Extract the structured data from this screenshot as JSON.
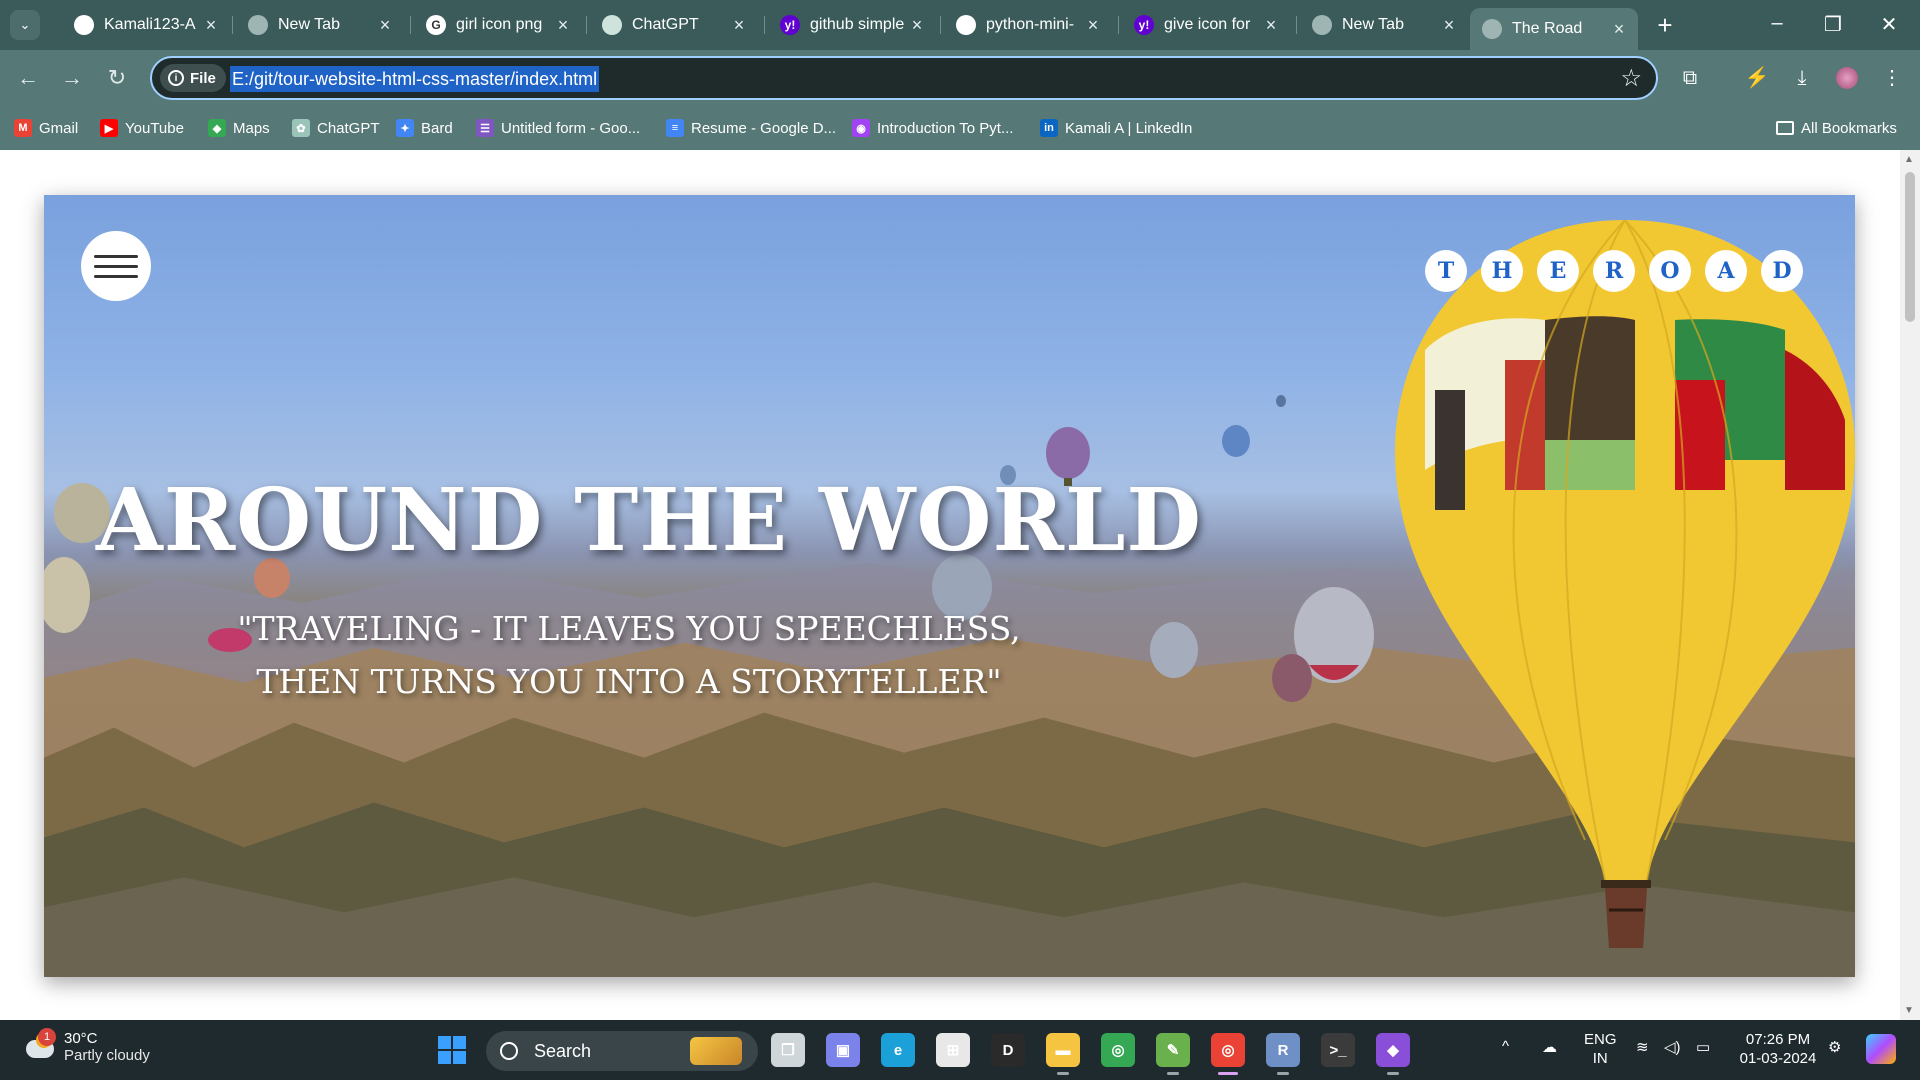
{
  "browser": {
    "tabs": [
      {
        "label": "Kamali123-A",
        "icon": "github-icon",
        "color": "#ffffff",
        "glyph": "",
        "active": false
      },
      {
        "label": "New Tab",
        "icon": "globe-icon",
        "color": "#9fb5b4",
        "glyph": "",
        "active": false
      },
      {
        "label": "girl icon png",
        "icon": "google-icon",
        "color": "#ffffff",
        "glyph": "G",
        "active": false
      },
      {
        "label": "ChatGPT",
        "icon": "chatgpt-icon",
        "color": "#cfe3dd",
        "glyph": "",
        "active": false
      },
      {
        "label": "github simple",
        "icon": "yahoo-icon",
        "color": "#6001d2",
        "glyph": "y!",
        "active": false
      },
      {
        "label": "python-mini-",
        "icon": "github-icon",
        "color": "#ffffff",
        "glyph": "",
        "active": false
      },
      {
        "label": "give icon for",
        "icon": "yahoo-icon",
        "color": "#6001d2",
        "glyph": "y!",
        "active": false
      },
      {
        "label": "New Tab",
        "icon": "globe-icon",
        "color": "#9fb5b4",
        "glyph": "",
        "active": false
      },
      {
        "label": "The Road",
        "icon": "globe-icon",
        "color": "#9fb5b4",
        "glyph": "",
        "active": true
      }
    ],
    "address": {
      "scheme_label": "File",
      "url": "E:/git/tour-website-html-css-master/index.html"
    },
    "bookmarks": [
      {
        "label": "Gmail",
        "icon": "gmail-icon",
        "color": "#ea4335",
        "glyph": "M"
      },
      {
        "label": "YouTube",
        "icon": "youtube-icon",
        "color": "#ff0000",
        "glyph": "▶"
      },
      {
        "label": "Maps",
        "icon": "maps-icon",
        "color": "#34a853",
        "glyph": "◆"
      },
      {
        "label": "ChatGPT",
        "icon": "chatgpt-icon",
        "color": "#9bc4b8",
        "glyph": "✿"
      },
      {
        "label": "Bard",
        "icon": "bard-icon",
        "color": "#4285f4",
        "glyph": "✦"
      },
      {
        "label": "Untitled form - Goo...",
        "icon": "google-forms-icon",
        "color": "#7e57c2",
        "glyph": "☰"
      },
      {
        "label": "Resume - Google D...",
        "icon": "google-docs-icon",
        "color": "#4285f4",
        "glyph": "≡"
      },
      {
        "label": "Introduction To Pyt...",
        "icon": "course-icon",
        "color": "#a142f4",
        "glyph": "◉"
      },
      {
        "label": "Kamali A | LinkedIn",
        "icon": "linkedin-icon",
        "color": "#0a66c2",
        "glyph": "in"
      }
    ],
    "all_bookmarks_label": "All Bookmarks"
  },
  "page": {
    "brand_letters": [
      "T",
      "H",
      "E",
      "R",
      "O",
      "A",
      "D"
    ],
    "headline": "AROUND THE WORLD",
    "quote_line1": "\"TRAVELING - IT LEAVES YOU SPEECHLESS,",
    "quote_line2": "THEN TURNS YOU INTO A STORYTELLER\""
  },
  "taskbar": {
    "weather": {
      "temp": "30°C",
      "condition": "Partly cloudy",
      "badge": "1"
    },
    "search_label": "Search",
    "language": {
      "line1": "ENG",
      "line2": "IN"
    },
    "time": "07:26 PM",
    "date": "01-03-2024",
    "apps": [
      {
        "name": "start-button",
        "color": "#3aa0ff",
        "glyph": "▦"
      },
      {
        "name": "task-view-button",
        "color": "#cfd6d9",
        "glyph": "❐"
      },
      {
        "name": "teams-app",
        "color": "#7b83eb",
        "glyph": "▣"
      },
      {
        "name": "edge-app",
        "color": "#1ba0d7",
        "glyph": "e"
      },
      {
        "name": "store-app",
        "color": "#e8e8e8",
        "glyph": "⊞"
      },
      {
        "name": "dell-app",
        "color": "#2a2a2a",
        "glyph": "D"
      },
      {
        "name": "file-explorer-app",
        "color": "#f5c542",
        "glyph": "▬"
      },
      {
        "name": "chrome-app",
        "color": "#34a853",
        "glyph": "◎"
      },
      {
        "name": "notepad-app",
        "color": "#6ab04c",
        "glyph": "✎"
      },
      {
        "name": "chrome-profile-app",
        "color": "#ea4335",
        "glyph": "◎"
      },
      {
        "name": "r-app",
        "color": "#6f8fc7",
        "glyph": "R"
      },
      {
        "name": "terminal-app",
        "color": "#3b3b3b",
        "glyph": ">_"
      },
      {
        "name": "visual-studio-app",
        "color": "#8a4fd8",
        "glyph": "◆"
      }
    ]
  }
}
